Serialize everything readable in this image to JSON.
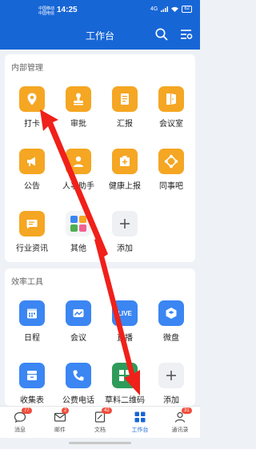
{
  "status": {
    "carrier_1": "中国移动",
    "carrier_2": "中国电信",
    "time": "14:25",
    "signal": "4G",
    "battery": "62"
  },
  "header": {
    "title": "工作台"
  },
  "internal": {
    "title": "内部管理",
    "items": [
      {
        "label": "打卡",
        "icon": "location-pin-icon"
      },
      {
        "label": "审批",
        "icon": "stamp-icon"
      },
      {
        "label": "汇报",
        "icon": "report-icon"
      },
      {
        "label": "会议室",
        "icon": "door-icon"
      },
      {
        "label": "公告",
        "icon": "megaphone-icon"
      },
      {
        "label": "人事助手",
        "icon": "person-icon"
      },
      {
        "label": "健康上报",
        "icon": "medical-box-icon"
      },
      {
        "label": "同事吧",
        "icon": "network-icon"
      },
      {
        "label": "行业资讯",
        "icon": "news-icon"
      },
      {
        "label": "其他",
        "icon": "grid-apps-icon"
      },
      {
        "label": "添加",
        "icon": "plus-icon"
      }
    ]
  },
  "efficiency": {
    "title": "效率工具",
    "items": [
      {
        "label": "日程",
        "icon": "calendar-icon"
      },
      {
        "label": "会议",
        "icon": "video-meeting-icon"
      },
      {
        "label": "直播",
        "icon": "live-icon",
        "icon_text": "LIVE"
      },
      {
        "label": "微盘",
        "icon": "cloud-disk-icon"
      },
      {
        "label": "收集表",
        "icon": "form-icon"
      },
      {
        "label": "公费电话",
        "icon": "phone-icon"
      },
      {
        "label": "草料二维码",
        "icon": "qr-code-icon"
      },
      {
        "label": "添加",
        "icon": "plus-icon"
      }
    ]
  },
  "tabbar": [
    {
      "label": "消息",
      "badge": "77"
    },
    {
      "label": "邮件",
      "badge": "2"
    },
    {
      "label": "文档",
      "badge": "42"
    },
    {
      "label": "工作台",
      "badge": "",
      "active": true
    },
    {
      "label": "通讯录",
      "badge": "31"
    }
  ],
  "colors": {
    "brand": "#1766d6",
    "orange": "#f5a623",
    "blue": "#3b86f2",
    "badge": "#f04d3c",
    "arrow": "#f0201a"
  }
}
